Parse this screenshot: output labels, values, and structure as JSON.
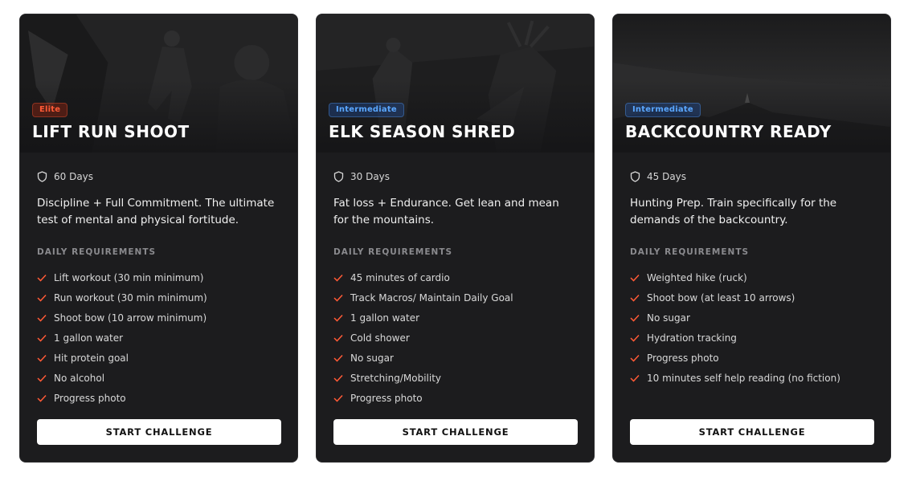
{
  "cards": [
    {
      "badge": "Elite",
      "badge_color": "#ff5a36",
      "title": "LIFT RUN SHOOT",
      "duration": "60 Days",
      "description": "Discipline + Full Commitment. The ultimate test of mental and physical fortitude.",
      "requirements_label": "DAILY REQUIREMENTS",
      "requirements": [
        "Lift workout (30 min minimum)",
        "Run workout (30 min minimum)",
        "Shoot bow (10 arrow minimum)",
        "1 gallon water",
        "Hit protein goal",
        "No alcohol",
        "Progress photo"
      ],
      "button_label": "START CHALLENGE"
    },
    {
      "badge": "Intermediate",
      "badge_color": "#5aa7ff",
      "title": "ELK SEASON SHRED",
      "duration": "30 Days",
      "description": "Fat loss + Endurance. Get lean and mean for the mountains.",
      "requirements_label": "DAILY REQUIREMENTS",
      "requirements": [
        "45 minutes of cardio",
        "Track Macros/ Maintain Daily Goal",
        "1 gallon water",
        "Cold shower",
        "No sugar",
        "Stretching/Mobility",
        "Progress photo"
      ],
      "button_label": "START CHALLENGE"
    },
    {
      "badge": "Intermediate",
      "badge_color": "#5aa7ff",
      "title": "BACKCOUNTRY READY",
      "duration": "45 Days",
      "description": "Hunting Prep. Train specifically for the demands of the backcountry.",
      "requirements_label": "DAILY REQUIREMENTS",
      "requirements": [
        "Weighted hike (ruck)",
        "Shoot bow (at least 10 arrows)",
        "No sugar",
        "Hydration tracking",
        "Progress photo",
        "10 minutes self help reading (no fiction)"
      ],
      "button_label": "START CHALLENGE"
    }
  ],
  "icons": {
    "duration": "shield-icon",
    "requirement": "check-icon"
  },
  "colors": {
    "card_background": "#1c1c1e",
    "check": "#ff5a36",
    "button_background": "#ffffff"
  }
}
